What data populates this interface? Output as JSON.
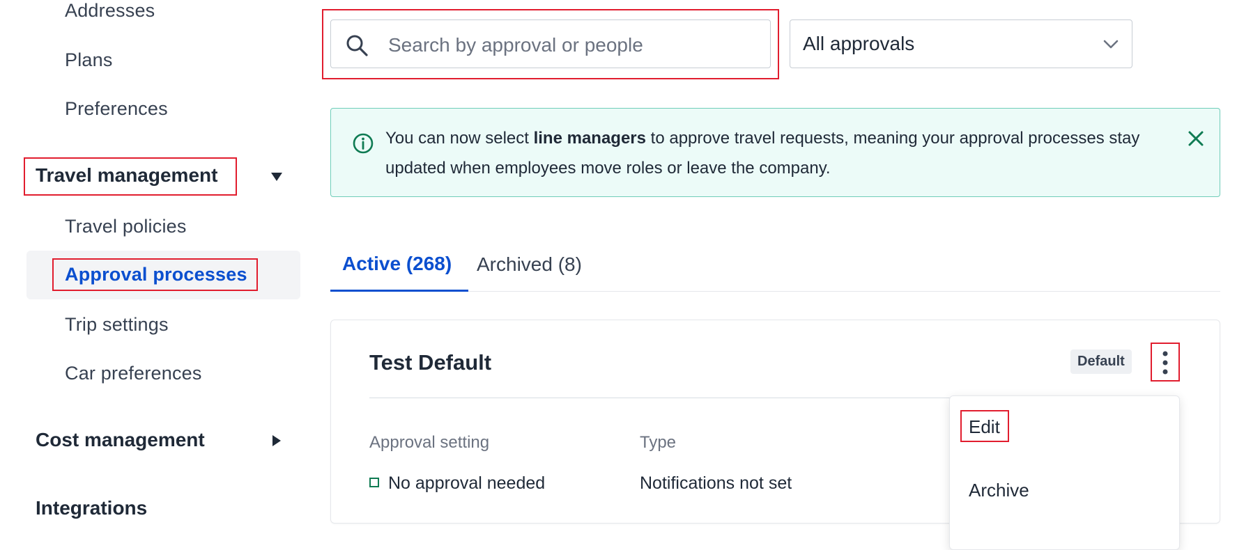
{
  "sidebar": {
    "account_items": [
      {
        "label": "Addresses"
      },
      {
        "label": "Plans"
      },
      {
        "label": "Preferences"
      }
    ],
    "travel_management": {
      "label": "Travel management",
      "expanded": true,
      "items": [
        {
          "label": "Travel policies"
        },
        {
          "label": "Approval processes",
          "active": true
        },
        {
          "label": "Trip settings"
        },
        {
          "label": "Car preferences"
        }
      ]
    },
    "cost_management": {
      "label": "Cost management",
      "expanded": false
    },
    "integrations": {
      "label": "Integrations"
    }
  },
  "search": {
    "placeholder": "Search by approval or people",
    "value": ""
  },
  "filter": {
    "selected": "All approvals"
  },
  "info_banner": {
    "text_before": "You can now select ",
    "text_bold": "line managers",
    "text_after": " to approve travel requests, meaning your approval processes stay updated when employees move roles or leave the company."
  },
  "tabs": [
    {
      "label": "Active (268)",
      "active": true
    },
    {
      "label": "Archived (8)",
      "active": false
    }
  ],
  "card": {
    "title": "Test Default",
    "badge": "Default",
    "approval_setting_label": "Approval setting",
    "approval_setting_value": "No approval needed",
    "type_label": "Type",
    "type_value": "Notifications not set"
  },
  "menu": {
    "items": [
      {
        "label": "Edit"
      },
      {
        "label": "Archive"
      }
    ]
  },
  "colors": {
    "accent": "#0b4fcf",
    "highlight": "#e11d2e",
    "banner_bg": "#ecfbf8",
    "banner_border": "#6fcdb9",
    "success": "#0f7b53"
  }
}
